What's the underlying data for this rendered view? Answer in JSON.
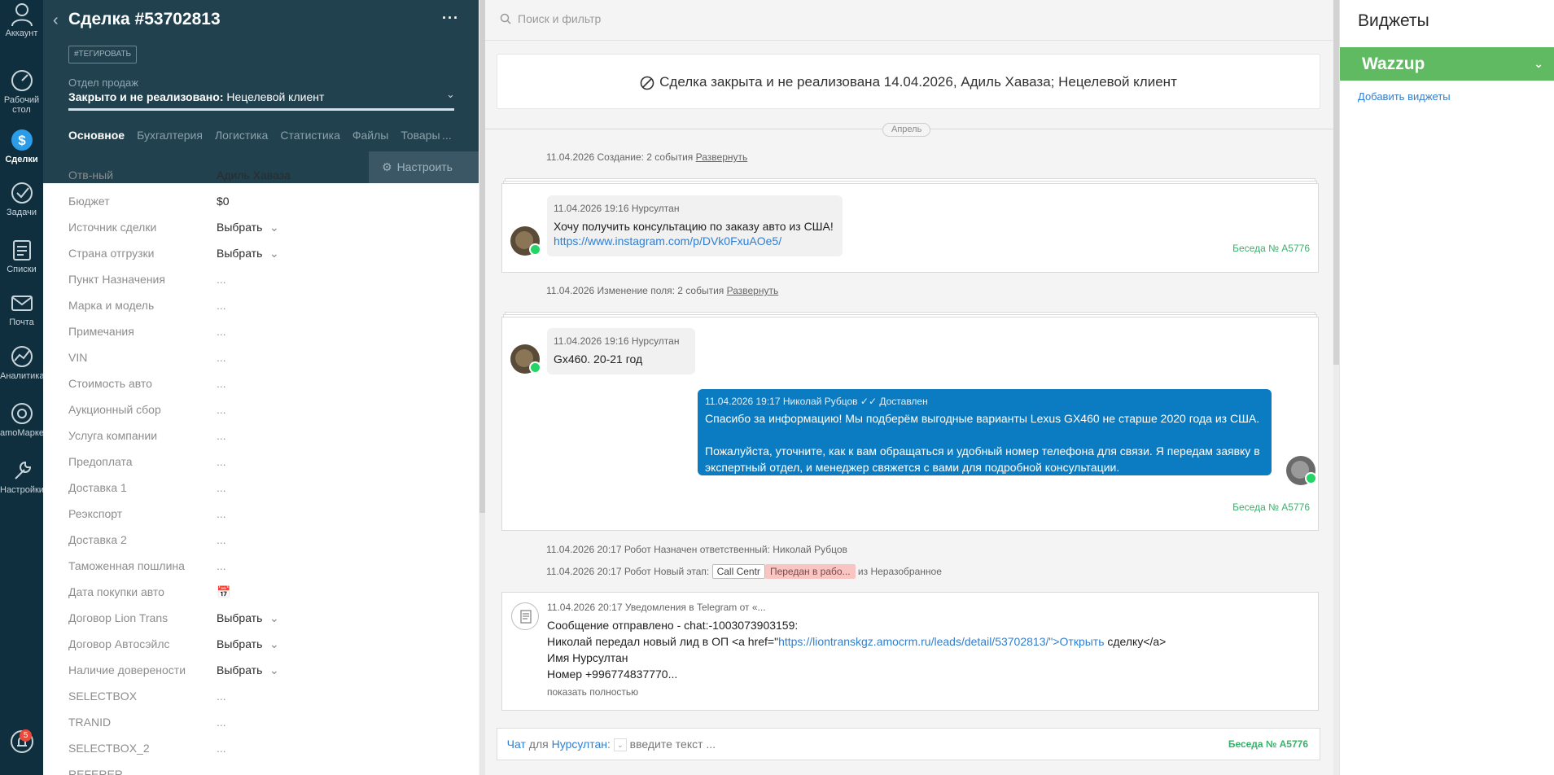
{
  "nav": {
    "items": [
      {
        "label": "Аккаунт",
        "icon": "account-icon"
      },
      {
        "label": "Рабочий стол",
        "icon": "dashboard-icon"
      },
      {
        "label": "Сделки",
        "icon": "deals-icon"
      },
      {
        "label": "Задачи",
        "icon": "tasks-icon"
      },
      {
        "label": "Списки",
        "icon": "lists-icon"
      },
      {
        "label": "Почта",
        "icon": "mail-icon"
      },
      {
        "label": "Аналитика",
        "icon": "analytics-icon"
      },
      {
        "label": "amoМаркет",
        "icon": "market-icon"
      },
      {
        "label": "Настройки",
        "icon": "settings-icon"
      }
    ],
    "notifications_count": "5"
  },
  "card": {
    "title": "Сделка #53702813",
    "tag_button": "#ТЕГИРОВАТЬ",
    "pipeline": "Отдел продаж",
    "status_prefix": "Закрыто и не реализовано:",
    "status_reason": "Нецелевой клиент",
    "tabs": [
      "Основное",
      "Бухгалтерия",
      "Логистика",
      "Статистика",
      "Файлы",
      "Товары"
    ],
    "tabs_more": "...",
    "setup_button": "Настроить",
    "fields": [
      {
        "label": "Отв-ный",
        "value": "Адиль Хаваза"
      },
      {
        "label": "Бюджет",
        "value": "$0"
      },
      {
        "label": "Источник сделки",
        "value": "Выбрать"
      },
      {
        "label": "Страна отгрузки",
        "value": "Выбрать"
      },
      {
        "label": "Пункт Назначения",
        "value": "..."
      },
      {
        "label": "Марка и модель",
        "value": "..."
      },
      {
        "label": "Примечания",
        "value": "..."
      },
      {
        "label": "VIN",
        "value": "..."
      },
      {
        "label": "Стоимость авто",
        "value": "..."
      },
      {
        "label": "Аукционный сбор",
        "value": "..."
      },
      {
        "label": "Услуга компании",
        "value": "..."
      },
      {
        "label": "Предоплата",
        "value": "..."
      },
      {
        "label": "Доставка 1",
        "value": "..."
      },
      {
        "label": "Реэкспорт",
        "value": "..."
      },
      {
        "label": "Доставка 2",
        "value": "..."
      },
      {
        "label": "Таможенная пошлина",
        "value": "..."
      },
      {
        "label": "Дата покупки авто",
        "value": "📅"
      },
      {
        "label": "Договор Lion Trans",
        "value": "Выбрать"
      },
      {
        "label": "Договор Автосэйлс",
        "value": "Выбрать"
      },
      {
        "label": "Наличие доверености",
        "value": "Выбрать"
      },
      {
        "label": "SELECTBOX",
        "value": "..."
      },
      {
        "label": "TRANID",
        "value": "..."
      },
      {
        "label": "SELECTBOX_2",
        "value": "..."
      },
      {
        "label": "REFERER",
        "value": ""
      }
    ]
  },
  "feed": {
    "search_placeholder": "Поиск и фильтр",
    "closed_banner": "Сделка закрыта и не реализована 14.04.2026, Адиль Хаваза; Нецелевой клиент",
    "month": "Апрель",
    "event1": {
      "text": "11.04.2026 Создание: 2 события",
      "link": "Развернуть"
    },
    "msg1": {
      "meta": "11.04.2026 19:16 Нурсултан",
      "text": "Хочу получить консультацию по заказу авто из США!",
      "link": "https://www.instagram.com/p/DVk0FxuAOe5/"
    },
    "conv_ref": "Беседа № A5776",
    "event2": {
      "text": "11.04.2026 Изменение поля: 2 события",
      "link": "Развернуть"
    },
    "msg2": {
      "meta": "11.04.2026 19:16 Нурсултан",
      "text": "Gx460. 20-21 год"
    },
    "msg3": {
      "meta": "11.04.2026 19:17 Николай Рубцов",
      "status": "Доставлен",
      "line1": "Спасибо за информацию! Мы подберём выгодные варианты Lexus GX460 не старше 2020 года из США.",
      "line2": "Пожалуйста, уточните, как к вам обращаться и удобный номер телефона для связи. Я передам заявку в",
      "line3": "экспертный отдел, и менеджер свяжется с вами для подробной консультации."
    },
    "robot1": "11.04.2026 20:17 Робот Назначен ответственный: Николай Рубцов",
    "robot2": {
      "prefix": "11.04.2026 20:17 Робот Новый этап:",
      "tag1": "Call Centr",
      "tag2": "Передан в рабо...",
      "suffix": "из Неразобранное"
    },
    "telegram": {
      "meta": "11.04.2026 20:17 Уведомления в Telegram от «...",
      "line1": "Сообщение отправлено - chat:-1003073903159:",
      "line2_pre": "Николай передал новый лид в ОП <a href=\"",
      "line2_link": "https://liontranskgz.amocrm.ru/leads/detail/53702813/\">Открыть",
      "line2_post": " сделку</a>",
      "line3": "Имя Нурсултан",
      "line4": "Номер +996774837770...",
      "show_full": "показать полностью"
    },
    "composer": {
      "chat": "Чат",
      "for": "для",
      "recipient": "Нурсултан",
      "placeholder": "введите текст ...",
      "conv": "Беседа № A5776"
    }
  },
  "widgets": {
    "title": "Виджеты",
    "wazzup": "Wazzup",
    "add": "Добавить виджеты"
  },
  "colors": {
    "nav_bg": "#0f2f3f",
    "card_head_bg": "#21414f",
    "accent_blue": "#0b7cc1",
    "wazzup_green": "#5fba61",
    "conv_green": "#36b36a"
  }
}
